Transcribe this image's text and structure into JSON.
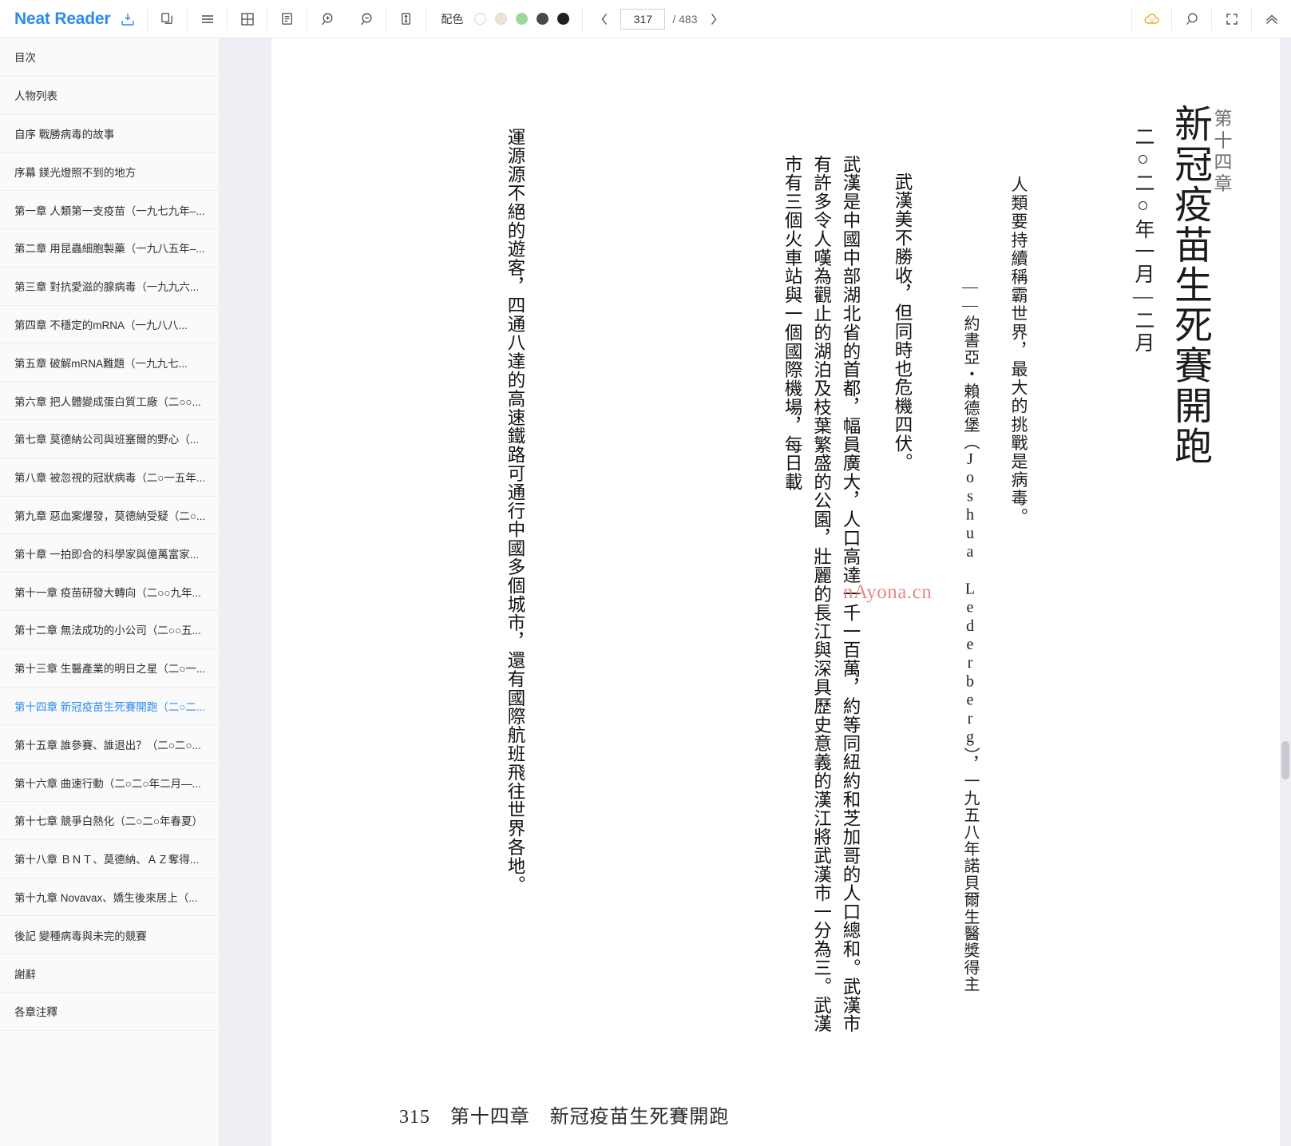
{
  "app": {
    "brand": "Neat Reader"
  },
  "toolbar": {
    "icons": [
      {
        "name": "save-to-shelf-icon",
        "glyph": "save"
      },
      {
        "name": "copy-icon",
        "glyph": "copy"
      },
      {
        "name": "menu-icon",
        "glyph": "menu"
      },
      {
        "name": "grid-layout-icon",
        "glyph": "grid"
      },
      {
        "name": "notes-icon",
        "glyph": "notes"
      },
      {
        "name": "zoom-in-icon",
        "glyph": "zoom-in"
      },
      {
        "name": "zoom-out-icon",
        "glyph": "zoom-out"
      },
      {
        "name": "line-height-icon",
        "glyph": "line-height"
      }
    ],
    "palette": {
      "label": "配色",
      "swatches": [
        "#ffffff",
        "#ece5d3",
        "#9ad99a",
        "#4a4a4a",
        "#1f1f1f"
      ]
    },
    "pager": {
      "prev_label": "‹",
      "next_label": "›",
      "current_page": "317",
      "total_label": "/ 483"
    },
    "right_icons": [
      {
        "name": "cloud-sync-icon",
        "color": "#f5a623"
      },
      {
        "name": "search-icon",
        "color": "#555555"
      },
      {
        "name": "fullscreen-icon",
        "color": "#555555"
      },
      {
        "name": "collapse-toolbar-icon",
        "color": "#555555"
      }
    ]
  },
  "sidebar": {
    "items": [
      {
        "label": "目次",
        "active": false
      },
      {
        "label": "人物列表",
        "active": false
      },
      {
        "label": "自序 戰勝病毒的故事",
        "active": false
      },
      {
        "label": "序幕 鎂光燈照不到的地方",
        "active": false
      },
      {
        "label": "第一章 人類第一支疫苗（一九七九年–...",
        "active": false
      },
      {
        "label": "第二章 用昆蟲細胞製藥（一九八五年–...",
        "active": false
      },
      {
        "label": "第三章 對抗愛滋的腺病毒（一九九六...",
        "active": false
      },
      {
        "label": "第四章 不穩定的mRNA（一九八八...",
        "active": false
      },
      {
        "label": "第五章 破解mRNA難題（一九九七...",
        "active": false
      },
      {
        "label": "第六章 把人體變成蛋白質工廠（二○○...",
        "active": false
      },
      {
        "label": "第七章 莫德納公司與班塞爾的野心（...",
        "active": false
      },
      {
        "label": "第八章 被忽視的冠狀病毒（二○一五年...",
        "active": false
      },
      {
        "label": "第九章 惡血案爆發，莫德納受疑（二○...",
        "active": false
      },
      {
        "label": "第十章 一拍即合的科學家與億萬富家...",
        "active": false
      },
      {
        "label": "第十一章 疫苗研發大轉向（二○○九年...",
        "active": false
      },
      {
        "label": "第十二章 無法成功的小公司（二○○五...",
        "active": false
      },
      {
        "label": "第十三章 生醫產業的明日之星（二○一...",
        "active": false
      },
      {
        "label": "第十四章 新冠疫苗生死賽開跑（二○二...",
        "active": true
      },
      {
        "label": "第十五章 誰參賽、誰退出？（二○二○...",
        "active": false
      },
      {
        "label": "第十六章 曲速行動（二○二○年二月—...",
        "active": false
      },
      {
        "label": "第十七章 競爭白熱化（二○二○年春夏）",
        "active": false
      },
      {
        "label": "第十八章 ＢＮＴ、莫德納、ＡＺ奪得...",
        "active": false
      },
      {
        "label": "第十九章 Novavax、嬌生後來居上（...",
        "active": false
      },
      {
        "label": "後記 變種病毒與未完的競賽",
        "active": false
      },
      {
        "label": "謝辭",
        "active": false
      },
      {
        "label": "各章注釋",
        "active": false
      }
    ]
  },
  "page": {
    "chapter_number": "第十四章",
    "chapter_title": "新冠疫苗生死賽開跑",
    "chapter_date": "二○二○年一月—二月",
    "quote": "人類要持續稱霸世界，最大的挑戰是病毒。",
    "attribution": "——約書亞・賴德堡（Joshua Lederberg），一九五八年諾貝爾生醫獎得主",
    "paragraph_1": "武漢美不勝收，但同時也危機四伏。",
    "paragraph_2": "武漢是中國中部湖北省的首都，幅員廣大，人口高達一千一百萬，約等同紐約和芝加哥的人口總和。武漢市有許多令人嘆為觀止的湖泊及枝葉繁盛的公園，壯麗的長江與深具歷史意義的漢江將武漢市一分為三。武漢市有三個火車站與一個國際機場，每日載",
    "paragraph_3": "運源源不絕的遊客，四通八達的高速鐵路可通行中國多個城市，還有國際航班飛往世界各地。",
    "watermark": "nAyona.cn",
    "footer": "315　第十四章　新冠疫苗生死賽開跑"
  }
}
